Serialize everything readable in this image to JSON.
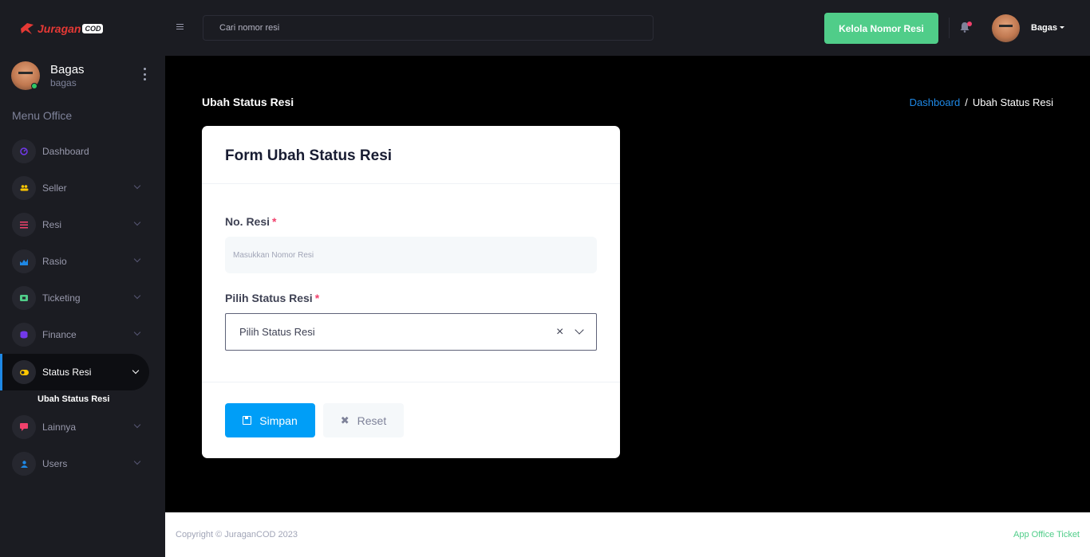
{
  "brand": {
    "name": "Juragan",
    "suffix": "COD"
  },
  "sidebar": {
    "profile": {
      "name": "Bagas",
      "username": "bagas"
    },
    "menu_title": "Menu Office",
    "items": [
      {
        "label": "Dashboard",
        "icon": "dashboard-icon",
        "color": "#7239ea"
      },
      {
        "label": "Seller",
        "icon": "users-icon",
        "color": "#ffc700"
      },
      {
        "label": "Resi",
        "icon": "list-icon",
        "color": "#f1416c"
      },
      {
        "label": "Rasio",
        "icon": "chart-icon",
        "color": "#1e88e5"
      },
      {
        "label": "Ticketing",
        "icon": "ticket-icon",
        "color": "#50cd89"
      },
      {
        "label": "Finance",
        "icon": "finance-icon",
        "color": "#7239ea"
      },
      {
        "label": "Status Resi",
        "icon": "toggle-icon",
        "color": "#ffc700"
      },
      {
        "label": "Lainnya",
        "icon": "comment-icon",
        "color": "#f1416c"
      },
      {
        "label": "Users",
        "icon": "user-icon",
        "color": "#1e88e5"
      }
    ],
    "submenu": {
      "label": "Ubah Status Resi"
    }
  },
  "header": {
    "search_placeholder": "Cari nomor resi",
    "kelola_label": "Kelola Nomor Resi",
    "user_name": "Bagas"
  },
  "page": {
    "title": "Ubah Status Resi",
    "breadcrumb": {
      "home": "Dashboard",
      "separator": "/",
      "current": "Ubah Status Resi"
    }
  },
  "form": {
    "title": "Form Ubah Status Resi",
    "resi_label": "No. Resi",
    "resi_placeholder": "Masukkan Nomor Resi",
    "status_label": "Pilih Status Resi",
    "status_value": "Pilih Status Resi",
    "required_mark": "*",
    "clear_glyph": "×",
    "save_label": "Simpan",
    "reset_label": "Reset",
    "reset_glyph": "✖"
  },
  "footer": {
    "copyright": "Copyright © JuraganCOD 2023",
    "app_name": "App Office Ticket"
  }
}
